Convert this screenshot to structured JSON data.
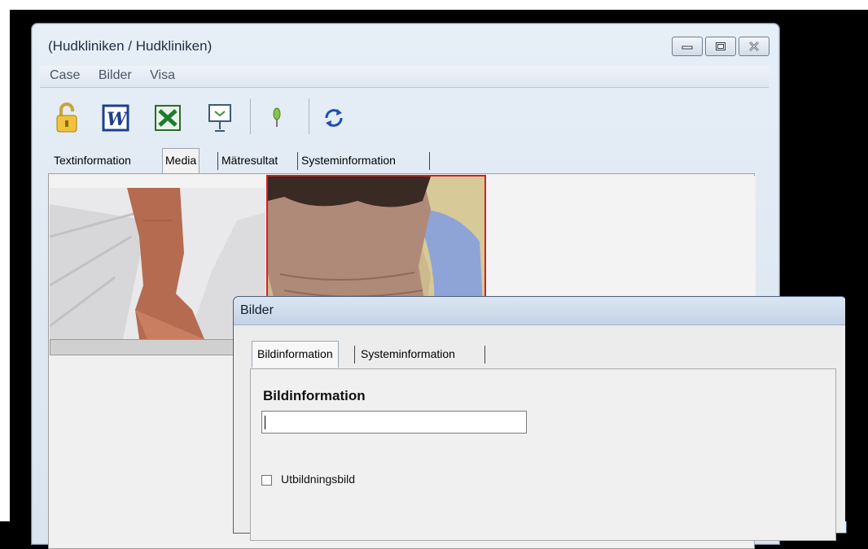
{
  "window": {
    "title": "(Hudkliniken / Hudkliniken)"
  },
  "menu": [
    "Case",
    "Bilder",
    "Visa"
  ],
  "toolbar": {
    "icons": [
      "lock-open-icon",
      "word-icon",
      "excel-icon",
      "presentation-icon",
      "pin-icon",
      "refresh-icon"
    ]
  },
  "tabs": [
    {
      "label": "Textinformation"
    },
    {
      "label": "Media"
    },
    {
      "label": "Mätresultat"
    },
    {
      "label": "Systeminformation"
    }
  ],
  "media": {
    "images": [
      "arm-photo",
      "neck-photo"
    ]
  },
  "dialog": {
    "title": "Bilder",
    "tabs": [
      {
        "label": "Bildinformation"
      },
      {
        "label": "Systeminformation"
      }
    ],
    "section_heading": "Bildinformation",
    "input_value": "",
    "checkbox_label": "Utbildningsbild"
  },
  "colors": {
    "selection_border": "#d41f1f",
    "titlebar": "#c3d3e5"
  }
}
